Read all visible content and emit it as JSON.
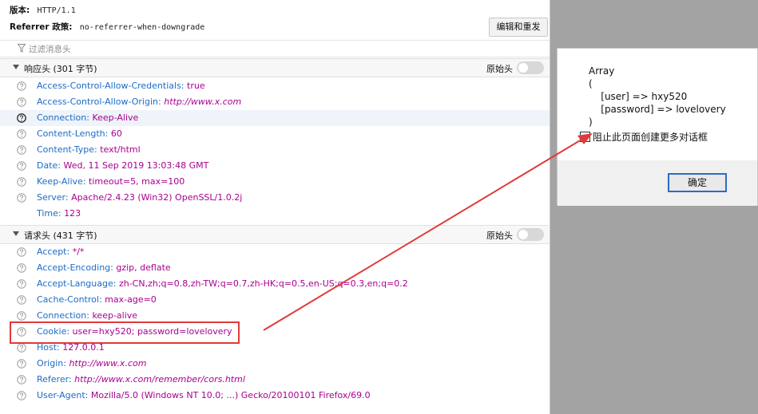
{
  "request_meta": {
    "version_label": "版本:",
    "version_value": "HTTP/1.1",
    "referrer_label": "Referrer 政策:",
    "referrer_value": "no-referrer-when-downgrade",
    "resend_label": "编辑和重发"
  },
  "filter": {
    "placeholder": "过滤消息头"
  },
  "response_headers": {
    "title": "响应头 (301 字节)",
    "raw_label": "原始头",
    "rows": [
      {
        "name": "Access-Control-Allow-Credentials:",
        "value": "true"
      },
      {
        "name": "Access-Control-Allow-Origin:",
        "value": "http://www.x.com"
      },
      {
        "name": "Connection:",
        "value": "Keep-Alive"
      },
      {
        "name": "Content-Length:",
        "value": "60"
      },
      {
        "name": "Content-Type:",
        "value": "text/html"
      },
      {
        "name": "Date:",
        "value": "Wed, 11 Sep 2019 13:03:48 GMT"
      },
      {
        "name": "Keep-Alive:",
        "value": "timeout=5, max=100"
      },
      {
        "name": "Server:",
        "value": "Apache/2.4.23 (Win32) OpenSSL/1.0.2j"
      },
      {
        "name": "Time:",
        "value": "123"
      }
    ]
  },
  "request_headers": {
    "title": "请求头 (431 字节)",
    "raw_label": "原始头",
    "rows": [
      {
        "name": "Accept:",
        "value": "*/*"
      },
      {
        "name": "Accept-Encoding:",
        "value": "gzip, deflate"
      },
      {
        "name": "Accept-Language:",
        "value": "zh-CN,zh;q=0.8,zh-TW;q=0.7,zh-HK;q=0.5,en-US;q=0.3,en;q=0.2"
      },
      {
        "name": "Cache-Control:",
        "value": "max-age=0"
      },
      {
        "name": "Connection:",
        "value": "keep-alive"
      },
      {
        "name": "Cookie:",
        "value": "user=hxy520; password=lovelovery"
      },
      {
        "name": "Host:",
        "value": "127.0.0.1"
      },
      {
        "name": "Origin:",
        "value": "http://www.x.com"
      },
      {
        "name": "Referer:",
        "value": "http://www.x.com/remember/cors.html"
      },
      {
        "name": "User-Agent:",
        "value": "Mozilla/5.0 (Windows NT 10.0; ...) Gecko/20100101 Firefox/69.0"
      }
    ]
  },
  "dialog": {
    "message_lines": [
      "Array",
      "(",
      "    [user] => hxy520",
      "    [password] => lovelovery",
      ")"
    ],
    "checkbox_label": "阻止此页面创建更多对话框",
    "ok_label": "确定"
  },
  "colors": {
    "header_name": "#1c6bc6",
    "header_value": "#a8008f",
    "annotation_red": "#e13a3a",
    "dialog_button_border": "#2d6cc3"
  },
  "icons": {
    "row_icon": "question-circle-icon",
    "filter_icon": "funnel-icon",
    "section_toggle": "triangle-down-icon"
  }
}
